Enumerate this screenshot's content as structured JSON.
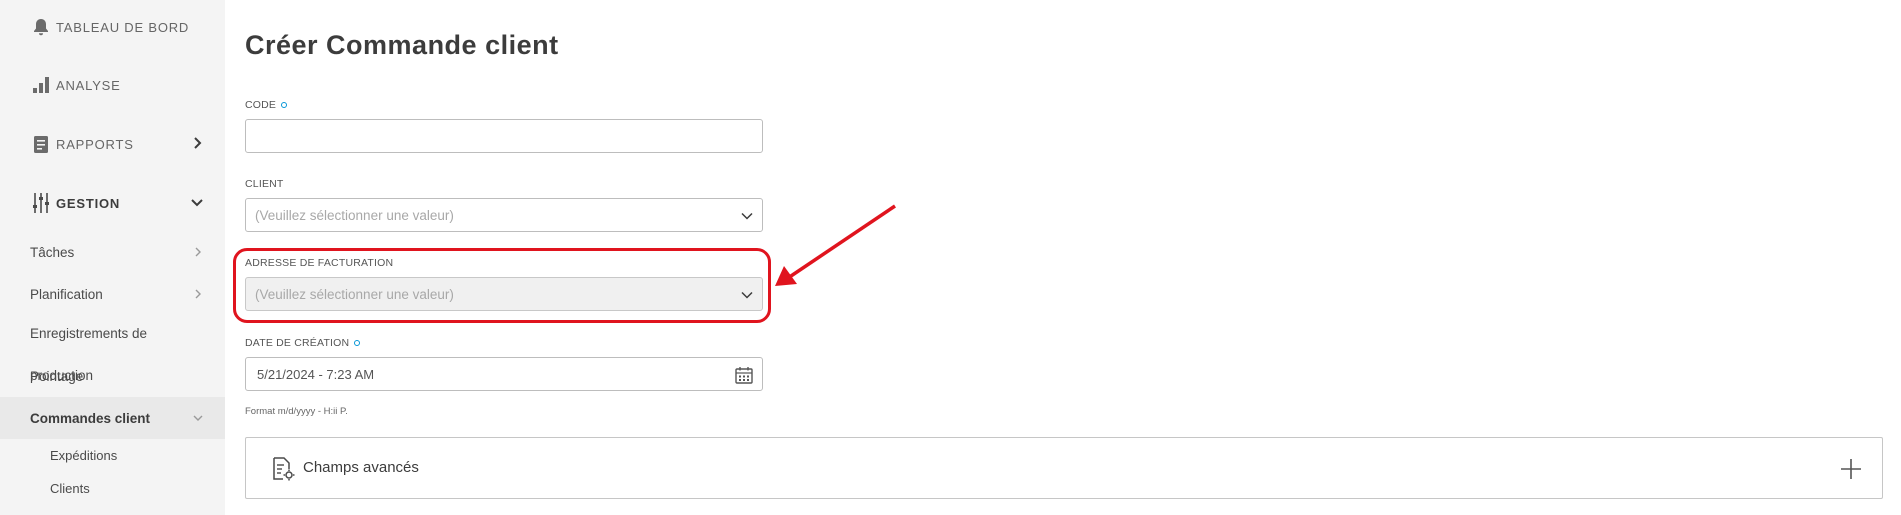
{
  "sidebar": {
    "main": [
      {
        "label": "TABLEAU DE BORD",
        "icon": "bell-icon"
      },
      {
        "label": "ANALYSE",
        "icon": "bar-chart-icon"
      },
      {
        "label": "RAPPORTS",
        "icon": "report-icon"
      },
      {
        "label": "GESTION",
        "icon": "sliders-icon"
      }
    ],
    "sub": [
      {
        "label": "Tâches"
      },
      {
        "label": "Planification"
      },
      {
        "label": "Commandes client"
      }
    ],
    "enregistrements_line1": "Enregistrements de",
    "enregistrements_line2a": "production",
    "enregistrements_line2b": "Pointage",
    "subsub": [
      {
        "label": "Expéditions"
      },
      {
        "label": "Clients"
      }
    ]
  },
  "form": {
    "title": "Créer Commande client",
    "code": {
      "label": "CODE",
      "value": ""
    },
    "client": {
      "label": "CLIENT",
      "placeholder": "(Veuillez sélectionner une valeur)"
    },
    "billing": {
      "label": "ADRESSE DE FACTURATION",
      "placeholder": "(Veuillez sélectionner une valeur)"
    },
    "created": {
      "label": "DATE DE CRÉATION",
      "value": "5/21/2024 - 7:23 AM",
      "hint": "Format m/d/yyyy - H:ii P."
    },
    "advanced": {
      "label": "Champs avancés"
    }
  },
  "colors": {
    "accent": "#0696d7",
    "highlight": "#e0141e"
  }
}
